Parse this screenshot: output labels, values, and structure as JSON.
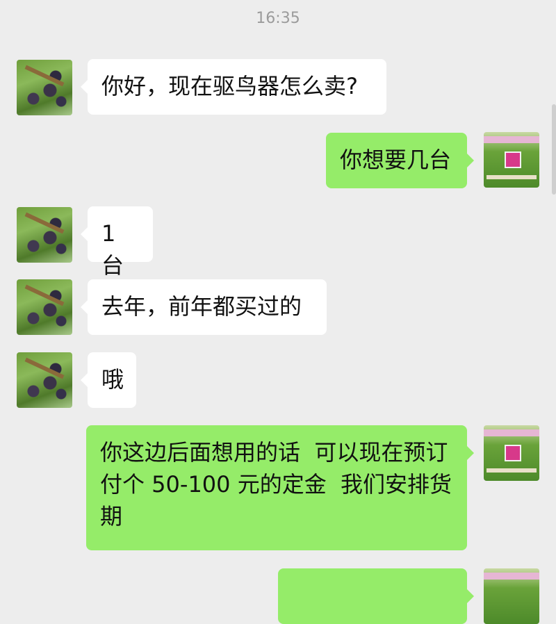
{
  "chat": {
    "timestamp": "16:35",
    "messages": [
      {
        "side": "left",
        "text": "你好，现在驱鸟器怎么卖?"
      },
      {
        "side": "right",
        "text": "你想要几台"
      },
      {
        "side": "left",
        "text": "1 台"
      },
      {
        "side": "left",
        "text": "去年，前年都买过的"
      },
      {
        "side": "left",
        "text": "哦"
      },
      {
        "side": "right",
        "text": "你这边后面想用的话  可以现在预订  付个 50-100 元的定金  我们安排货期"
      },
      {
        "side": "right",
        "text": ""
      }
    ]
  },
  "colors": {
    "background": "#ededed",
    "received_bubble": "#ffffff",
    "sent_bubble": "#95ec69",
    "timestamp_text": "#9b9b9b"
  },
  "icons": {
    "contact_avatar": "grapes-photo-avatar",
    "own_avatar": "bird-repeller-product-avatar"
  }
}
